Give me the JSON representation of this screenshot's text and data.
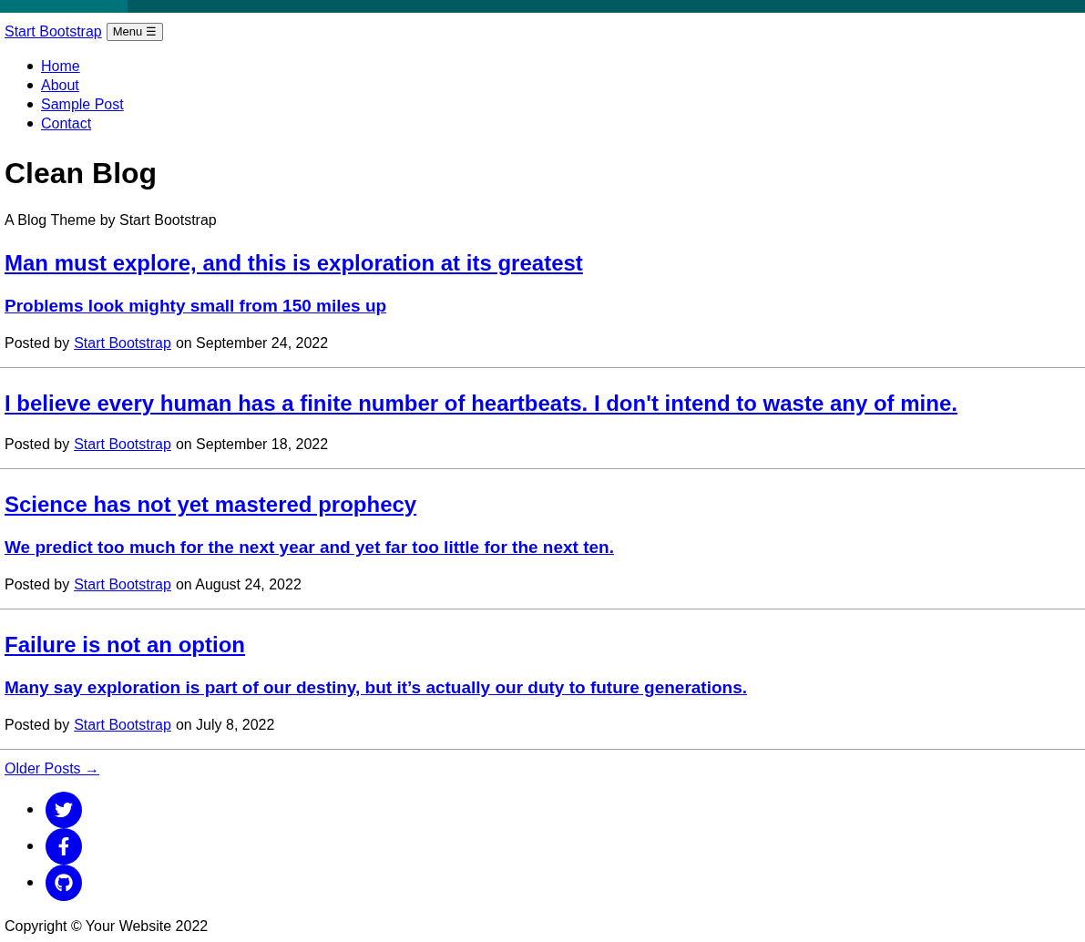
{
  "navbar": {
    "brand": "Start Bootstrap",
    "toggle_label": "Menu",
    "toggle_icon": "☰"
  },
  "nav_items": [
    {
      "label": "Home"
    },
    {
      "label": "About"
    },
    {
      "label": "Sample Post"
    },
    {
      "label": "Contact"
    }
  ],
  "header": {
    "title": "Clean Blog",
    "subtitle": "A Blog Theme by Start Bootstrap"
  },
  "posts": [
    {
      "title": "Man must explore, and this is exploration at its greatest",
      "subtitle": "Problems look mighty small from 150 miles up",
      "posted_by": "Posted by",
      "author": "Start Bootstrap",
      "date": "on September 24, 2022"
    },
    {
      "title": "I believe every human has a finite number of heartbeats. I don't intend to waste any of mine.",
      "posted_by": "Posted by",
      "author": "Start Bootstrap",
      "date": "on September 18, 2022"
    },
    {
      "title": "Science has not yet mastered prophecy",
      "subtitle": "We predict too much for the next year and yet far too little for the next ten.",
      "posted_by": "Posted by",
      "author": "Start Bootstrap",
      "date": "on August 24, 2022"
    },
    {
      "title": "Failure is not an option",
      "subtitle": "Many say exploration is part of our destiny, but it’s actually our duty to future generations.",
      "posted_by": "Posted by",
      "author": "Start Bootstrap",
      "date": "on July 8, 2022"
    }
  ],
  "older_posts": "Older Posts →",
  "social_links": [
    {
      "kind": "twitter"
    },
    {
      "kind": "facebook"
    },
    {
      "kind": "github"
    }
  ],
  "footer": {
    "copyright": "Copyright © Your Website 2022"
  }
}
